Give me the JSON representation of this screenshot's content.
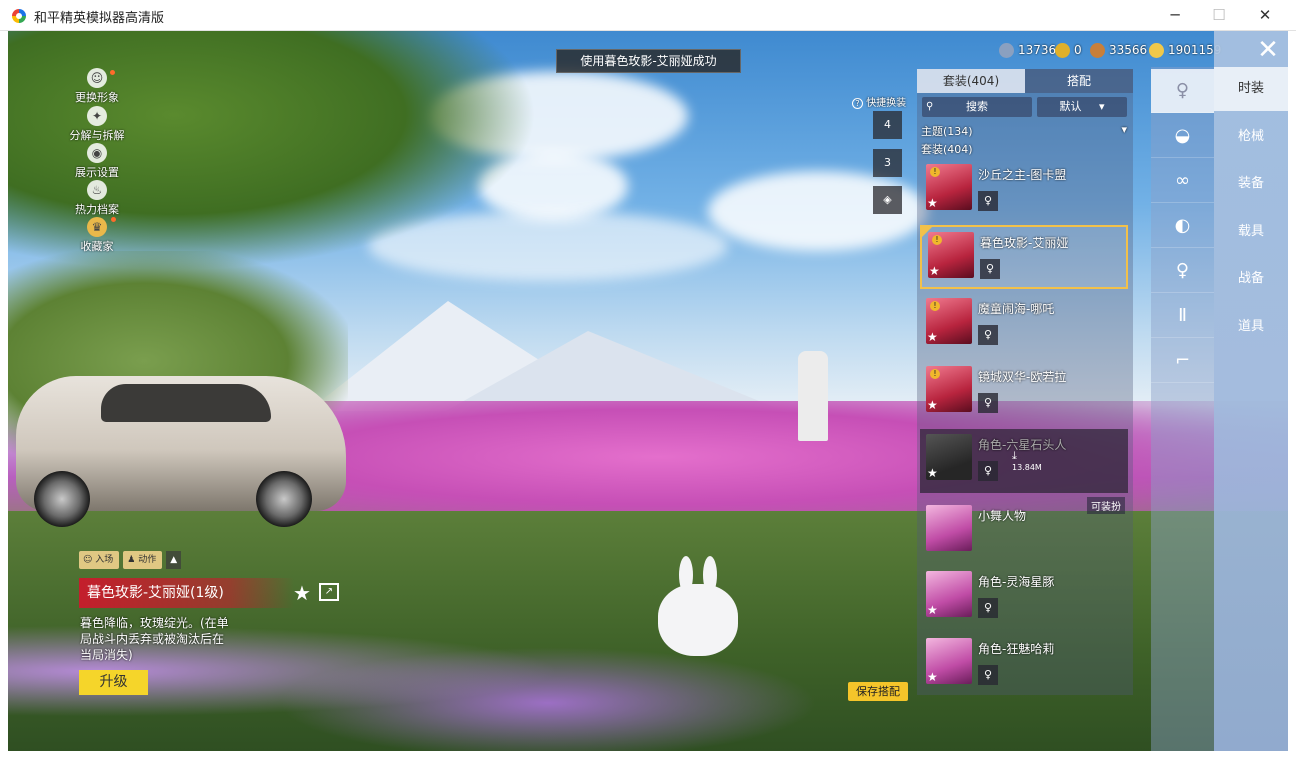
{
  "window": {
    "title": "和平精英模拟器高清版",
    "minimize": "─",
    "maximize": "☐",
    "close": "✕"
  },
  "toast": "使用暮色玫影-艾丽娅成功",
  "left_menu": [
    {
      "label": "更换形象",
      "icon": "person-icon",
      "glyph": "☺"
    },
    {
      "label": "分解与拆解",
      "icon": "puzzle-icon",
      "glyph": "✦"
    },
    {
      "label": "展示设置",
      "icon": "eye-icon",
      "glyph": "◉"
    },
    {
      "label": "热力档案",
      "icon": "flame-icon",
      "glyph": "♨"
    },
    {
      "label": "收藏家",
      "icon": "crown-icon",
      "glyph": "♛"
    }
  ],
  "currency": [
    {
      "value": "13736",
      "icon": "globe-coin-icon",
      "color": "#8aa0c0"
    },
    {
      "value": "0",
      "icon": "gold-token-icon",
      "color": "#e0b02a"
    },
    {
      "value": "33566",
      "icon": "bronze-coin-icon",
      "color": "#c87f3a"
    },
    {
      "value": "1901159",
      "icon": "gold-coin-icon",
      "color": "#f0c84a"
    }
  ],
  "close_glyph": "✕",
  "categories": [
    {
      "label": "时装",
      "active": true
    },
    {
      "label": "枪械",
      "active": false
    },
    {
      "label": "装备",
      "active": false
    },
    {
      "label": "载具",
      "active": false
    },
    {
      "label": "战备",
      "active": false
    },
    {
      "label": "道具",
      "active": false
    }
  ],
  "subcategories": [
    {
      "icon": "outfit-icon",
      "glyph": "♀"
    },
    {
      "icon": "cap-icon",
      "glyph": "◒"
    },
    {
      "icon": "glasses-icon",
      "glyph": "∞"
    },
    {
      "icon": "mask-icon",
      "glyph": "◐"
    },
    {
      "icon": "outfit-icon",
      "glyph": "♀"
    },
    {
      "icon": "pants-icon",
      "glyph": "Ⅱ"
    },
    {
      "icon": "shoes-icon",
      "glyph": "⌐"
    }
  ],
  "panel": {
    "tabs": [
      "套装(404)",
      "搭配"
    ],
    "search_placeholder": "搜索",
    "search_glyph": "⚲",
    "sort_label": "默认",
    "sort_glyph": "▾",
    "filter_theme": "主题(134)",
    "filter_theme_arrow": "▾",
    "filter_suits": "套装(404)",
    "available_tag": "可装扮",
    "items": [
      {
        "name": "沙丘之主-图卡盟",
        "state": "normal",
        "thumb": "red"
      },
      {
        "name": "暮色玫影-艾丽娅",
        "state": "selected",
        "thumb": "red"
      },
      {
        "name": "魔童闹海-哪吒",
        "state": "normal",
        "thumb": "red"
      },
      {
        "name": "镜城双华-欧若拉",
        "state": "normal",
        "thumb": "red"
      },
      {
        "name": "角色-六星石头人",
        "state": "dim",
        "thumb": "dark",
        "download_size": "13.84M"
      },
      {
        "name": "小舞人物",
        "state": "normal",
        "thumb": "pink"
      },
      {
        "name": "角色-灵海星豚",
        "state": "normal",
        "thumb": "pink"
      },
      {
        "name": "角色-狂魅哈莉",
        "state": "normal",
        "thumb": "pink"
      }
    ]
  },
  "quick_change": {
    "label": "快捷换装",
    "help_glyph": "?",
    "slots": [
      "4",
      "3",
      "◈"
    ]
  },
  "save_button": "保存搭配",
  "mode_tabs": {
    "entry": "入场",
    "action": "动作",
    "up_glyph": "▲"
  },
  "skin": {
    "title": "暮色玫影-艾丽娅(1级)",
    "fav_glyph": "★",
    "share_glyph": "↗",
    "description": "暮色降临，玫瑰绽光。(在单局战斗内丢弃或被淘汰后在当局消失)",
    "upgrade": "升级"
  },
  "star_glyph": "★",
  "badge_glyph": "!",
  "mini_glyph": "♀",
  "download_glyph": "⤓"
}
